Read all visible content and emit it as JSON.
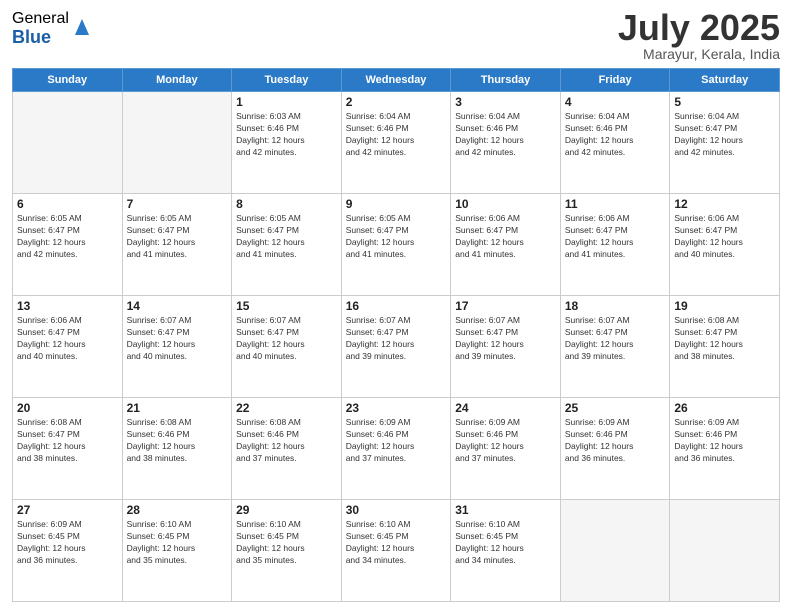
{
  "header": {
    "logo_general": "General",
    "logo_blue": "Blue",
    "title": "July 2025",
    "location": "Marayur, Kerala, India"
  },
  "days_of_week": [
    "Sunday",
    "Monday",
    "Tuesday",
    "Wednesday",
    "Thursday",
    "Friday",
    "Saturday"
  ],
  "weeks": [
    [
      {
        "day": "",
        "empty": true
      },
      {
        "day": "",
        "empty": true
      },
      {
        "day": "1",
        "sunrise": "6:03 AM",
        "sunset": "6:46 PM",
        "daylight": "12 hours and 42 minutes."
      },
      {
        "day": "2",
        "sunrise": "6:04 AM",
        "sunset": "6:46 PM",
        "daylight": "12 hours and 42 minutes."
      },
      {
        "day": "3",
        "sunrise": "6:04 AM",
        "sunset": "6:46 PM",
        "daylight": "12 hours and 42 minutes."
      },
      {
        "day": "4",
        "sunrise": "6:04 AM",
        "sunset": "6:46 PM",
        "daylight": "12 hours and 42 minutes."
      },
      {
        "day": "5",
        "sunrise": "6:04 AM",
        "sunset": "6:47 PM",
        "daylight": "12 hours and 42 minutes."
      }
    ],
    [
      {
        "day": "6",
        "sunrise": "6:05 AM",
        "sunset": "6:47 PM",
        "daylight": "12 hours and 42 minutes."
      },
      {
        "day": "7",
        "sunrise": "6:05 AM",
        "sunset": "6:47 PM",
        "daylight": "12 hours and 41 minutes."
      },
      {
        "day": "8",
        "sunrise": "6:05 AM",
        "sunset": "6:47 PM",
        "daylight": "12 hours and 41 minutes."
      },
      {
        "day": "9",
        "sunrise": "6:05 AM",
        "sunset": "6:47 PM",
        "daylight": "12 hours and 41 minutes."
      },
      {
        "day": "10",
        "sunrise": "6:06 AM",
        "sunset": "6:47 PM",
        "daylight": "12 hours and 41 minutes."
      },
      {
        "day": "11",
        "sunrise": "6:06 AM",
        "sunset": "6:47 PM",
        "daylight": "12 hours and 41 minutes."
      },
      {
        "day": "12",
        "sunrise": "6:06 AM",
        "sunset": "6:47 PM",
        "daylight": "12 hours and 40 minutes."
      }
    ],
    [
      {
        "day": "13",
        "sunrise": "6:06 AM",
        "sunset": "6:47 PM",
        "daylight": "12 hours and 40 minutes."
      },
      {
        "day": "14",
        "sunrise": "6:07 AM",
        "sunset": "6:47 PM",
        "daylight": "12 hours and 40 minutes."
      },
      {
        "day": "15",
        "sunrise": "6:07 AM",
        "sunset": "6:47 PM",
        "daylight": "12 hours and 40 minutes."
      },
      {
        "day": "16",
        "sunrise": "6:07 AM",
        "sunset": "6:47 PM",
        "daylight": "12 hours and 39 minutes."
      },
      {
        "day": "17",
        "sunrise": "6:07 AM",
        "sunset": "6:47 PM",
        "daylight": "12 hours and 39 minutes."
      },
      {
        "day": "18",
        "sunrise": "6:07 AM",
        "sunset": "6:47 PM",
        "daylight": "12 hours and 39 minutes."
      },
      {
        "day": "19",
        "sunrise": "6:08 AM",
        "sunset": "6:47 PM",
        "daylight": "12 hours and 38 minutes."
      }
    ],
    [
      {
        "day": "20",
        "sunrise": "6:08 AM",
        "sunset": "6:47 PM",
        "daylight": "12 hours and 38 minutes."
      },
      {
        "day": "21",
        "sunrise": "6:08 AM",
        "sunset": "6:46 PM",
        "daylight": "12 hours and 38 minutes."
      },
      {
        "day": "22",
        "sunrise": "6:08 AM",
        "sunset": "6:46 PM",
        "daylight": "12 hours and 37 minutes."
      },
      {
        "day": "23",
        "sunrise": "6:09 AM",
        "sunset": "6:46 PM",
        "daylight": "12 hours and 37 minutes."
      },
      {
        "day": "24",
        "sunrise": "6:09 AM",
        "sunset": "6:46 PM",
        "daylight": "12 hours and 37 minutes."
      },
      {
        "day": "25",
        "sunrise": "6:09 AM",
        "sunset": "6:46 PM",
        "daylight": "12 hours and 36 minutes."
      },
      {
        "day": "26",
        "sunrise": "6:09 AM",
        "sunset": "6:46 PM",
        "daylight": "12 hours and 36 minutes."
      }
    ],
    [
      {
        "day": "27",
        "sunrise": "6:09 AM",
        "sunset": "6:45 PM",
        "daylight": "12 hours and 36 minutes."
      },
      {
        "day": "28",
        "sunrise": "6:10 AM",
        "sunset": "6:45 PM",
        "daylight": "12 hours and 35 minutes."
      },
      {
        "day": "29",
        "sunrise": "6:10 AM",
        "sunset": "6:45 PM",
        "daylight": "12 hours and 35 minutes."
      },
      {
        "day": "30",
        "sunrise": "6:10 AM",
        "sunset": "6:45 PM",
        "daylight": "12 hours and 34 minutes."
      },
      {
        "day": "31",
        "sunrise": "6:10 AM",
        "sunset": "6:45 PM",
        "daylight": "12 hours and 34 minutes."
      },
      {
        "day": "",
        "empty": true
      },
      {
        "day": "",
        "empty": true
      }
    ]
  ],
  "labels": {
    "sunrise_label": "Sunrise:",
    "sunset_label": "Sunset:",
    "daylight_label": "Daylight:"
  }
}
